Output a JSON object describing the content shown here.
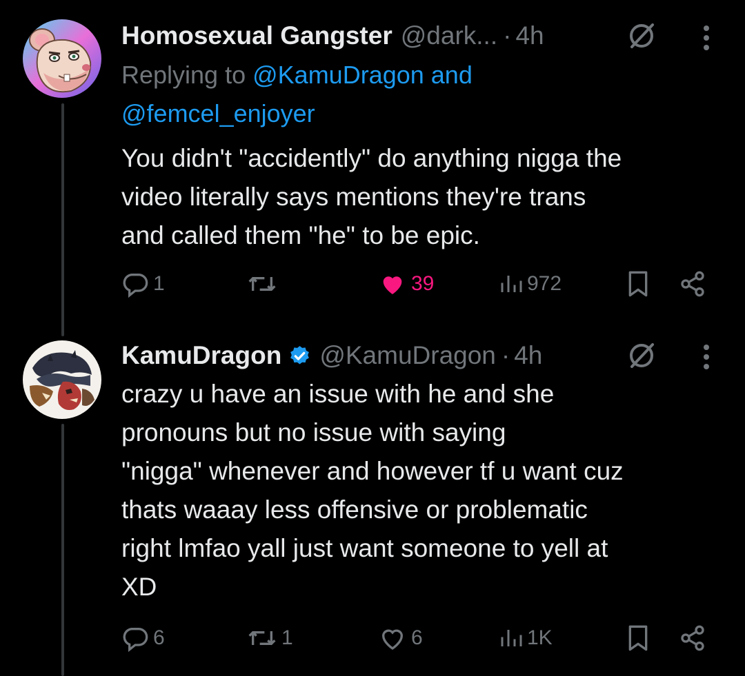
{
  "tweets": [
    {
      "name": "Homosexual Gangster",
      "handle": "@dark...",
      "dot": "·",
      "time": "4h",
      "replying_prefix": "Replying to ",
      "mention_1": "@KamuDragon",
      "mention_join": " and",
      "mention_2": "@femcel_enjoyer",
      "text": "You didn't \"accidently\" do anything nigga the\nvideo literally says mentions they're trans\nand called them \"he\" to be epic.",
      "replies": "1",
      "reposts": "",
      "likes": "39",
      "liked": true,
      "views": "972",
      "avatar_icon": "rat-character-avatar-icon"
    },
    {
      "name": "KamuDragon",
      "verified": true,
      "handle": "@KamuDragon",
      "dot": "·",
      "time": "4h",
      "text": "crazy u have an issue with he and she\npronouns but no issue with saying\n\"nigga\" whenever and however tf u want cuz\nthats waaay less offensive or problematic\nright lmfao yall just want someone to yell at\nXD",
      "replies": "6",
      "reposts": "1",
      "likes": "6",
      "liked": false,
      "views": "1K",
      "avatar_icon": "dragon-character-avatar-icon"
    }
  ],
  "colors": {
    "background": "#000000",
    "text": "#e7e9ea",
    "muted": "#71767b",
    "accent": "#1d9bf0",
    "like": "#f91880",
    "thread_line": "#333639"
  }
}
